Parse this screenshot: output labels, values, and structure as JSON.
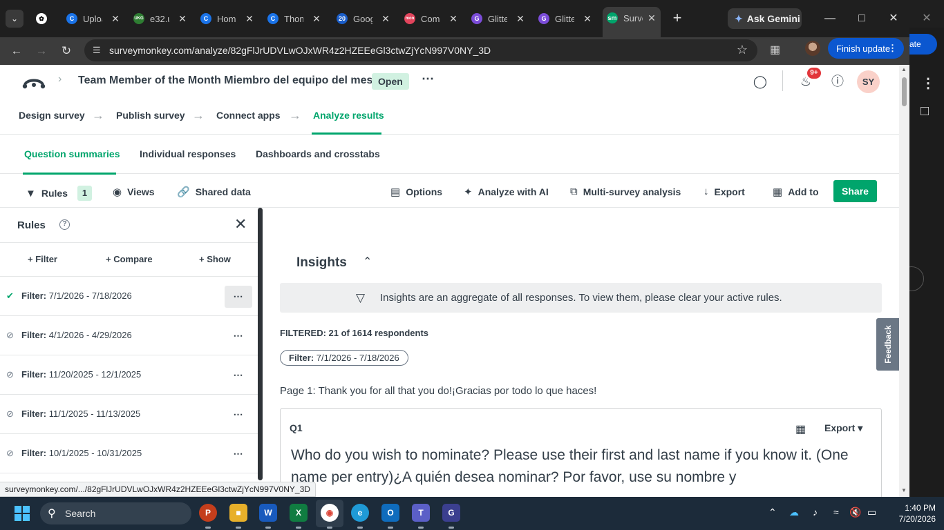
{
  "browser": {
    "tabs": [
      {
        "title": "Uploa",
        "fav": "C",
        "color": "#1a73e8"
      },
      {
        "title": "e32.u",
        "fav": "UKG",
        "color": "#2e7d32"
      },
      {
        "title": "Home",
        "fav": "C",
        "color": "#1a73e8"
      },
      {
        "title": "Thom",
        "fav": "C",
        "color": "#1a73e8"
      },
      {
        "title": "Goog",
        "fav": "20",
        "color": "#1a5dc8"
      },
      {
        "title": "Com",
        "fav": "mon",
        "color": "#e2445c"
      },
      {
        "title": "Glitte",
        "fav": "G",
        "color": "#7b4cd8"
      },
      {
        "title": "Glitte",
        "fav": "G",
        "color": "#7b4cd8"
      },
      {
        "title": "Surve",
        "fav": "sm",
        "color": "#00a56c"
      }
    ],
    "ask_gemini": "Ask Gemini",
    "url": "surveymonkey.com/analyze/82gFlJrUDVLwOJxWR4z2HZEEeGl3ctwZjYcN997V0NY_3D",
    "finish_update": "Finish update",
    "behind_window_text": "ate",
    "status_url": "surveymonkey.com/.../82gFlJrUDVLwOJxWR4z2HZEEeGl3ctwZjYcN997V0NY_3D"
  },
  "header": {
    "survey_title": "Team Member of the Month Miembro del equipo del mes",
    "status_badge": "Open",
    "notification_count": "9+",
    "avatar_initials": "SY"
  },
  "steps": [
    "Design survey",
    "Publish survey",
    "Connect apps",
    "Analyze results"
  ],
  "subtabs": [
    "Question summaries",
    "Individual responses",
    "Dashboards and crosstabs"
  ],
  "toolbar": {
    "rules": "Rules",
    "rules_count": "1",
    "views": "Views",
    "shared_data": "Shared data",
    "options": "Options",
    "analyze_ai": "Analyze with AI",
    "multi_survey": "Multi-survey analysis",
    "export": "Export",
    "add_to": "Add to",
    "share": "Share"
  },
  "rules_panel": {
    "title": "Rules",
    "actions": [
      "+ Filter",
      "+ Compare",
      "+ Show"
    ],
    "rules": [
      {
        "label": "Filter:",
        "value": "7/1/2026 - 7/18/2026",
        "active": true
      },
      {
        "label": "Filter:",
        "value": "4/1/2026 - 4/29/2026",
        "active": false
      },
      {
        "label": "Filter:",
        "value": "11/20/2025 - 12/1/2025",
        "active": false
      },
      {
        "label": "Filter:",
        "value": "11/1/2025 - 11/13/2025",
        "active": false
      },
      {
        "label": "Filter:",
        "value": "10/1/2025 - 10/31/2025",
        "active": false
      }
    ]
  },
  "main": {
    "insights_title": "Insights",
    "insights_notice": "Insights are an aggregate of all responses. To view them, please clear your active rules.",
    "filtered_text": "FILTERED: 21 of 1614 respondents",
    "filter_pill_label": "Filter:",
    "filter_pill_value": "7/1/2026 - 7/18/2026",
    "page_line": "Page 1: Thank you for all that you do!¡Gracias por todo lo que haces!",
    "question": {
      "number": "Q1",
      "export": "Export",
      "text": "Who do you wish to nominate? Please use their first and last name if you know it. (One name per entry)¿A quién desea nominar? Por favor, use su nombre y"
    },
    "feedback": "Feedback"
  },
  "taskbar": {
    "search_placeholder": "Search",
    "time": "1:40 PM",
    "date": "7/20/2026"
  }
}
